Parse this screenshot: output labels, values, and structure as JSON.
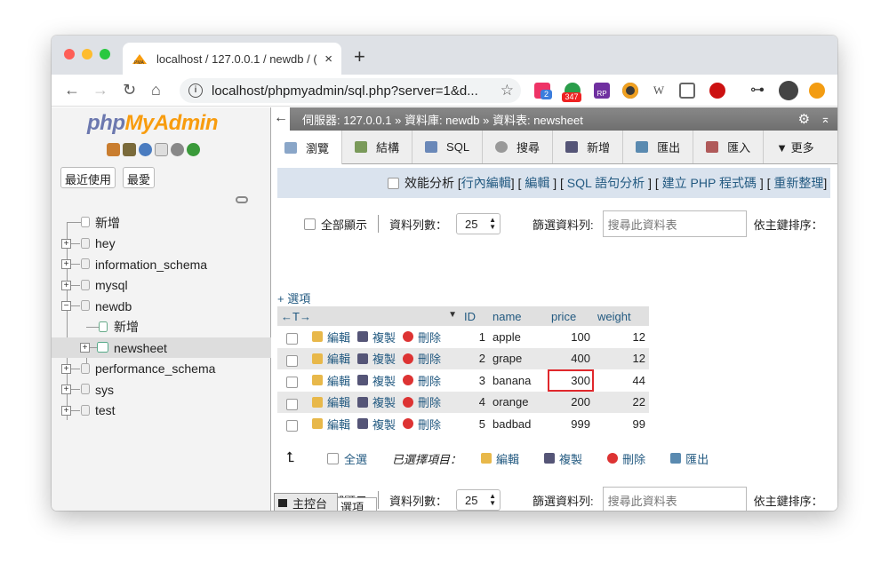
{
  "browser": {
    "tab_title": "localhost / 127.0.0.1 / newdb / (",
    "tab_close": "×",
    "new_tab": "+",
    "url": "localhost/phpmyadmin/sql.php?server=1&d...",
    "ext_badge_1": "2",
    "ext_badge_2": "347",
    "ext_rp": "RP",
    "ext_w": "W"
  },
  "sidebar": {
    "logo_a": "php",
    "logo_b": "MyAdmin",
    "recent_label": "最近使用",
    "favorites_label": "最愛",
    "tree": [
      {
        "label": "新增",
        "type": "new"
      },
      {
        "label": "hey",
        "type": "db"
      },
      {
        "label": "information_schema",
        "type": "db"
      },
      {
        "label": "mysql",
        "type": "db"
      },
      {
        "label": "newdb",
        "type": "db-open"
      },
      {
        "label": "新增",
        "type": "sub-new"
      },
      {
        "label": "newsheet",
        "type": "table"
      },
      {
        "label": "performance_schema",
        "type": "db"
      },
      {
        "label": "sys",
        "type": "db"
      },
      {
        "label": "test",
        "type": "db"
      }
    ]
  },
  "breadcrumb": {
    "back": "←",
    "server": "伺服器: 127.0.0.1",
    "database": "資料庫: newdb",
    "table": "資料表: newsheet",
    "sep": "»"
  },
  "tabs": [
    {
      "label": "瀏覽",
      "active": true
    },
    {
      "label": "結構"
    },
    {
      "label": "SQL"
    },
    {
      "label": "搜尋"
    },
    {
      "label": "新增"
    },
    {
      "label": "匯出"
    },
    {
      "label": "匯入"
    },
    {
      "label": "▼ 更多"
    }
  ],
  "profiling": {
    "label": "效能分析",
    "links": [
      "行內編輯",
      "編輯",
      "SQL 語句分析",
      "建立 PHP 程式碼",
      "重新整理"
    ]
  },
  "controls": {
    "show_all": "全部顯示",
    "rows_label": "資料列數：",
    "rows_value": "25",
    "filter_label": "篩選資料列:",
    "filter_placeholder": "搜尋此資料表",
    "sort_label": "依主鍵排序："
  },
  "options_link": "+ 選項",
  "table": {
    "arrows": "←T→",
    "columns": [
      "ID",
      "name",
      "price",
      "weight"
    ],
    "actions": {
      "edit": "編輯",
      "copy": "複製",
      "delete": "刪除"
    },
    "rows": [
      {
        "id": "1",
        "name": "apple",
        "price": "100",
        "weight": "12"
      },
      {
        "id": "2",
        "name": "grape",
        "price": "400",
        "weight": "12"
      },
      {
        "id": "3",
        "name": "banana",
        "price": "300",
        "weight": "44"
      },
      {
        "id": "4",
        "name": "orange",
        "price": "200",
        "weight": "22"
      },
      {
        "id": "5",
        "name": "badbad",
        "price": "999",
        "weight": "99"
      }
    ]
  },
  "bulk": {
    "select_all": "全選",
    "with_selected": "已選擇項目：",
    "edit": "編輯",
    "copy": "複製",
    "delete": "刪除",
    "export": "匯出"
  },
  "console": {
    "label": "主控台",
    "behind_tab": "選項"
  },
  "colors": {
    "link": "#235a81",
    "highlight_box": "#e0282c",
    "breadcrumb_bg": "#7a7a7a",
    "profile_bg": "#dae3ee"
  }
}
